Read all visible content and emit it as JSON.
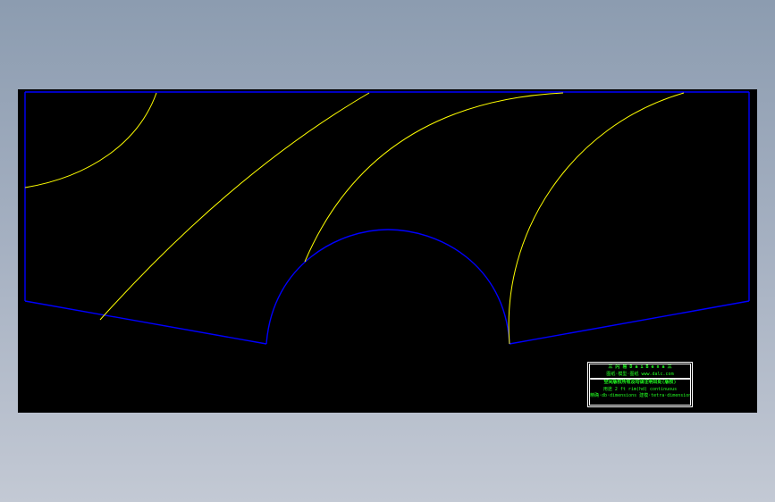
{
  "viewport": {
    "background": "#000000",
    "outline_color": "#0000ff",
    "curve_color": "#ffff00"
  },
  "title_block": {
    "border_color": "#ffffff",
    "text_color": "#22ff22",
    "line1": "三 闪 易   D a i B e n a   三",
    "line2": "图纸·模型·图纸        www.dalc.com",
    "line3": "空间版权所有及均请注明出处(版权)",
    "line4": "用途  2 ft rim(hd) continuous",
    "line5": "精确·db·dimensions  建模·tetra·dimensions"
  }
}
